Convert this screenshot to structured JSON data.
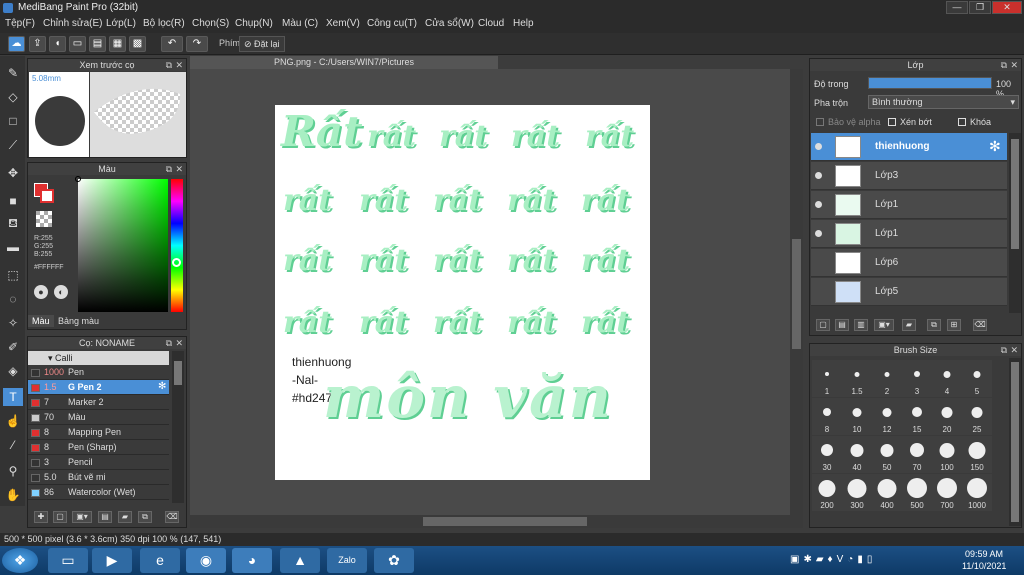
{
  "window": {
    "title": "MediBang Paint Pro (32bit)",
    "min": "—",
    "max": "❐",
    "close": "✕"
  },
  "menu": [
    "Tệp(F)",
    "Chỉnh sửa(E)",
    "Lớp(L)",
    "Bộ lọc(R)",
    "Chọn(S)",
    "Chụp(N)",
    "Màu (C)",
    "Xem(V)",
    "Công cụ(T)",
    "Cửa sổ(W)",
    "Cloud",
    "Help"
  ],
  "toolbar": {
    "phim_label": "Phím",
    "reset_label": "Đặt lại"
  },
  "preview_panel": {
    "title": "Xem trước cọ",
    "size": "5.08mm"
  },
  "color_panel": {
    "title": "Màu",
    "r": "R:255",
    "g": "G:255",
    "b": "B:255",
    "hex": "#FFFFFF",
    "tab1": "Màu",
    "tab2": "Bảng màu",
    "accent": "#4a8fd6"
  },
  "brush_panel": {
    "title": "Cọ: NONAME",
    "group": "Calli",
    "items": [
      {
        "size": "1000",
        "name": "Pen",
        "color": "#333333"
      },
      {
        "size": "1.5",
        "name": "G Pen 2",
        "color": "#e03030"
      },
      {
        "size": "7",
        "name": "Marker 2",
        "color": "#e03030"
      },
      {
        "size": "70",
        "name": "Màu",
        "color": "#cccccc"
      },
      {
        "size": "8",
        "name": "Mapping Pen",
        "color": "#e03030"
      },
      {
        "size": "8",
        "name": "Pen (Sharp)",
        "color": "#e03030"
      },
      {
        "size": "3",
        "name": "Pencil",
        "color": "#333333"
      },
      {
        "size": "5.0",
        "name": "Bút vẽ mi",
        "color": "#333333"
      },
      {
        "size": "86",
        "name": "Watercolor (Wet)",
        "color": "#7fd0ff"
      }
    ]
  },
  "document": {
    "tab": "PNG.png - C:/Users/WIN7/Pictures",
    "words": [
      "Rất",
      "rất",
      "rất",
      "rất",
      "rất"
    ],
    "signature_lines": [
      "thienhuong",
      "-Nal-",
      "#hd247"
    ],
    "big_text": "môn văn"
  },
  "layer_panel": {
    "title": "Lớp",
    "opacity_label": "Độ trong",
    "opacity_value": "100 %",
    "opacity": 1.0,
    "blend_label": "Pha trộn",
    "blend_value": "Bình thường",
    "protect_alpha": "Bảo vệ alpha",
    "clipping": "Xén bớt",
    "lock": "Khóa",
    "layers": [
      {
        "name": "thienhuong",
        "visible": true,
        "selected": true
      },
      {
        "name": "Lớp3",
        "visible": true,
        "selected": false
      },
      {
        "name": "Lớp1",
        "visible": true,
        "selected": false
      },
      {
        "name": "Lớp1",
        "visible": true,
        "selected": false
      },
      {
        "name": "Lớp6",
        "visible": false,
        "selected": false
      },
      {
        "name": "Lớp5",
        "visible": false,
        "selected": false
      }
    ]
  },
  "brush_size_panel": {
    "title": "Brush Size",
    "sizes": [
      "1",
      "1.5",
      "2",
      "3",
      "4",
      "5",
      "8",
      "10",
      "12",
      "15",
      "20",
      "25",
      "30",
      "40",
      "50",
      "70",
      "100",
      "150",
      "200",
      "300",
      "400",
      "500",
      "700",
      "1000"
    ]
  },
  "status": {
    "dimensions": "500 * 500 pixel",
    "physical": "(3.6 * 3.6cm)",
    "dpi": "350 dpi",
    "zoom": "100 %",
    "coords": "(147, 541)"
  },
  "taskbar": {
    "time": "09:59 AM",
    "date": "11/10/2021"
  }
}
